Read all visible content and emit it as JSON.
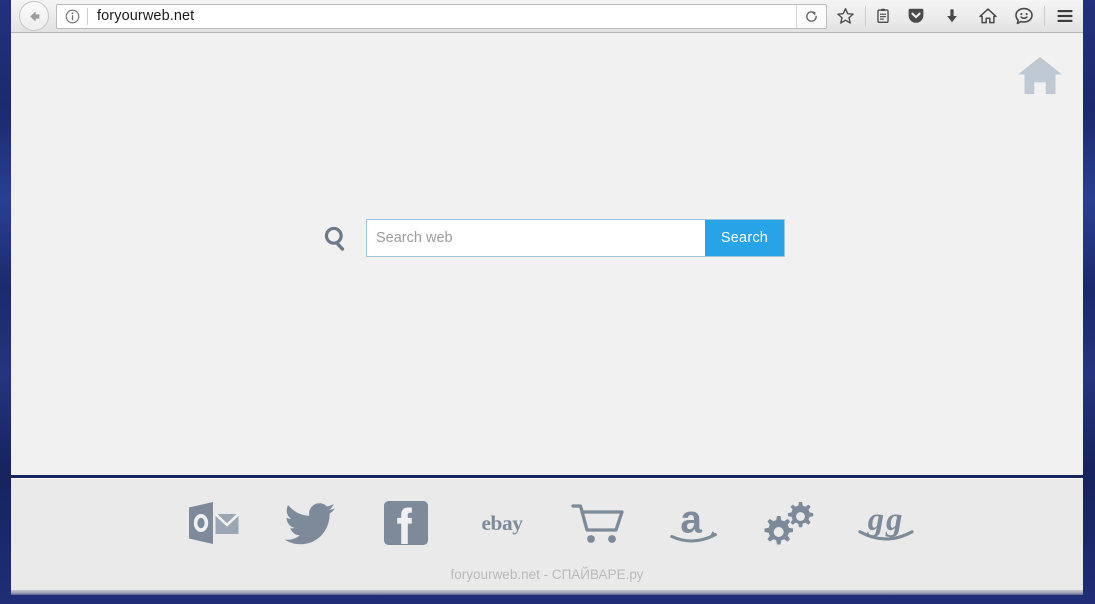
{
  "browser": {
    "back_button": "Back",
    "identity_icon": "info-circle-icon",
    "url": "foryourweb.net",
    "reload_label": "Reload",
    "toolbar_icons": [
      {
        "name": "bookmark-star-icon",
        "label": "Bookmark this page"
      },
      {
        "name": "reader-view-icon",
        "label": "Reader view"
      },
      {
        "name": "pocket-icon",
        "label": "Save to Pocket"
      },
      {
        "name": "downloads-icon",
        "label": "Downloads"
      },
      {
        "name": "home-icon",
        "label": "Home"
      },
      {
        "name": "sync-smiley-icon",
        "label": "Account"
      },
      {
        "name": "hamburger-menu-icon",
        "label": "Open menu"
      }
    ]
  },
  "page": {
    "home_corner_icon": "home-icon",
    "search": {
      "glass_icon": "search-magnifier-icon",
      "input_value": "",
      "placeholder": "Search web",
      "button_label": "Search"
    }
  },
  "footer": {
    "shortcuts": [
      {
        "name": "outlook-icon",
        "label": "Outlook"
      },
      {
        "name": "twitter-icon",
        "label": "Twitter"
      },
      {
        "name": "facebook-icon",
        "label": "Facebook"
      },
      {
        "name": "ebay-icon",
        "label": "ebay"
      },
      {
        "name": "cart-icon",
        "label": "Shopping"
      },
      {
        "name": "amazon-icon",
        "label": "Amazon"
      },
      {
        "name": "gears-icon",
        "label": "Settings"
      },
      {
        "name": "gg-icon",
        "label": "gg"
      }
    ],
    "watermark": "foryourweb.net - СПАЙВАРЕ.ру"
  },
  "colors": {
    "accent_blue": "#27a3e8",
    "page_background": "#f1f1f1",
    "footer_background": "#eaeaea",
    "icon_gray": "#77818f",
    "desktop_blue": "#1d2f72"
  }
}
